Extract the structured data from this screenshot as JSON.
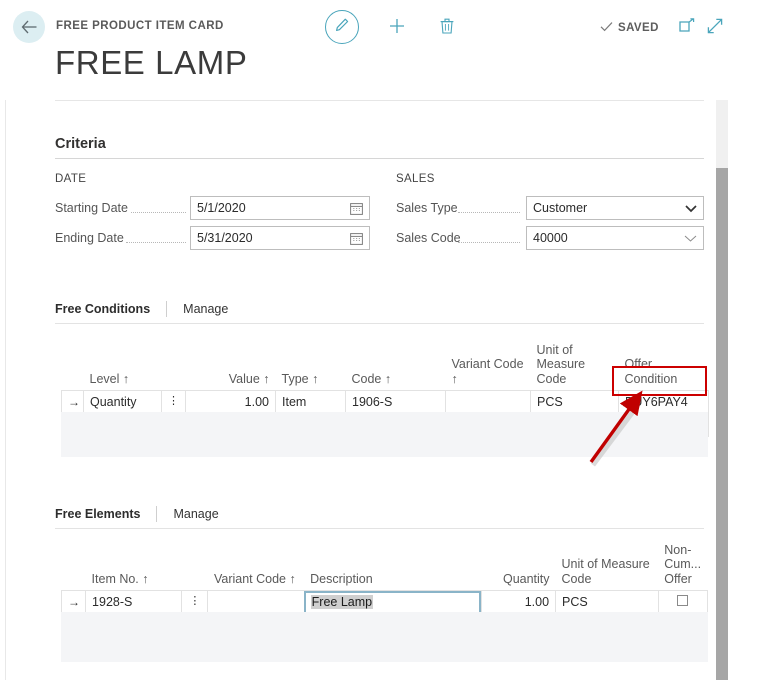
{
  "header": {
    "breadcrumb": "FREE PRODUCT ITEM CARD",
    "title": "FREE LAMP",
    "back_icon": "arrow-left-icon",
    "edit_icon": "pencil-icon",
    "new_icon": "plus-icon",
    "delete_icon": "trash-icon",
    "saved_label": "SAVED",
    "saved_check_icon": "check-icon",
    "open_new_window_icon": "open-in-new-window-icon",
    "expand_icon": "expand-diagonal-icon",
    "accent_color": "#4aa5bb"
  },
  "criteria": {
    "group_title": "Criteria",
    "date_group_label": "DATE",
    "sales_group_label": "SALES",
    "fields": {
      "starting_date": {
        "label": "Starting Date",
        "value": "5/1/2020",
        "icon": "calendar-icon"
      },
      "ending_date": {
        "label": "Ending Date",
        "value": "5/31/2020",
        "icon": "calendar-icon"
      },
      "sales_type": {
        "label": "Sales Type",
        "value": "Customer",
        "icon": "chevron-down-icon"
      },
      "sales_code": {
        "label": "Sales Code",
        "value": "40000",
        "icon": "chevron-down-thin-icon"
      }
    }
  },
  "free_conditions": {
    "part_title": "Free Conditions",
    "manage_label": "Manage",
    "expand_icon": "open-in-full-icon",
    "columns": [
      "Level ↑",
      "",
      "Value ↑",
      "Type ↑",
      "Code ↑",
      "Variant Code ↑",
      "Unit of Measure Code",
      "Offer Condition"
    ],
    "rows": [
      {
        "selected": true,
        "level": "Quantity",
        "value": "1.00",
        "type": "Item",
        "code": "1906-S",
        "variant_code": "",
        "unit_of_measure_code": "PCS",
        "offer_condition": "BUY6PAY4"
      }
    ],
    "blank_rows": 1,
    "highlight": {
      "cell": "offer_condition",
      "color": "#cc0000"
    }
  },
  "free_elements": {
    "part_title": "Free Elements",
    "manage_label": "Manage",
    "expand_icon": "open-in-full-icon",
    "columns": [
      "Item No. ↑",
      "",
      "Variant Code ↑",
      "Description",
      "Quantity",
      "Unit of Measure Code",
      "Non-Cum... Offer"
    ],
    "rows": [
      {
        "selected": true,
        "item_no": "1928-S",
        "variant_code": "",
        "description": "Free Lamp",
        "description_selected": true,
        "quantity": "1.00",
        "unit_of_measure_code": "PCS",
        "non_cum_offer_checked": false
      }
    ],
    "blank_rows": 1
  },
  "scrollbar": {
    "name": "vertical-scrollbar"
  }
}
